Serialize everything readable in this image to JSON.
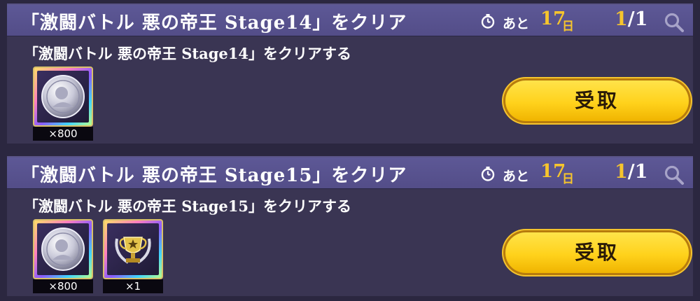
{
  "missions": [
    {
      "title": "「激闘バトル 悪の帝王 Stage14」をクリア",
      "remaining_prefix": "あと",
      "remaining_days": "17",
      "remaining_unit": "日",
      "progress_current": "1",
      "progress_total": "/1",
      "description": "「激闘バトル 悪の帝王 Stage14」をクリアする",
      "rewards": [
        {
          "icon": "silver-medal-icon",
          "quantity": "×800"
        }
      ],
      "claim_label": "受取"
    },
    {
      "title": "「激闘バトル 悪の帝王 Stage15」をクリア",
      "remaining_prefix": "あと",
      "remaining_days": "17",
      "remaining_unit": "日",
      "progress_current": "1",
      "progress_total": "/1",
      "description": "「激闘バトル 悪の帝王 Stage15」をクリアする",
      "rewards": [
        {
          "icon": "silver-medal-icon",
          "quantity": "×800"
        },
        {
          "icon": "trophy-icon",
          "quantity": "×1"
        }
      ],
      "claim_label": "受取"
    }
  ],
  "colors": {
    "header": "#5d5896",
    "panel": "#3a3553",
    "accent": "#f6c52d",
    "button": "#ffd21c"
  }
}
